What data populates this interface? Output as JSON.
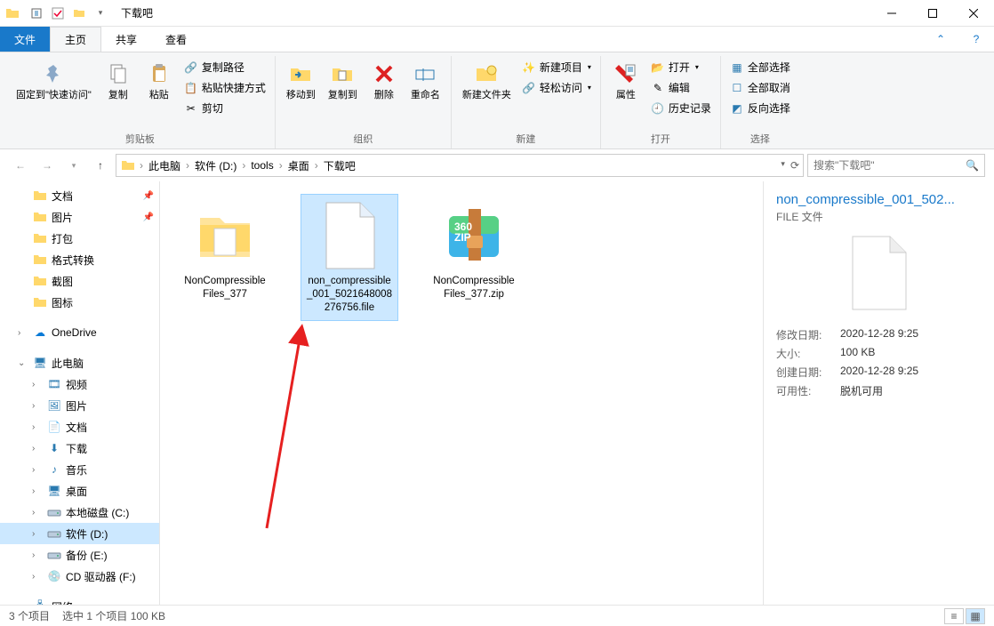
{
  "window": {
    "title": "下载吧"
  },
  "ribbon": {
    "tabs": {
      "file": "文件",
      "home": "主页",
      "share": "共享",
      "view": "查看"
    },
    "groups": {
      "clipboard": {
        "label": "剪贴板",
        "pin": "固定到\"快速访问\"",
        "copy": "复制",
        "paste": "粘贴",
        "copy_path": "复制路径",
        "paste_shortcut": "粘贴快捷方式",
        "cut": "剪切"
      },
      "organize": {
        "label": "组织",
        "move_to": "移动到",
        "copy_to": "复制到",
        "delete": "删除",
        "rename": "重命名"
      },
      "new": {
        "label": "新建",
        "new_folder": "新建文件夹",
        "new_item": "新建项目",
        "easy_access": "轻松访问"
      },
      "open": {
        "label": "打开",
        "properties": "属性",
        "open": "打开",
        "edit": "编辑",
        "history": "历史记录"
      },
      "select": {
        "label": "选择",
        "select_all": "全部选择",
        "select_none": "全部取消",
        "invert": "反向选择"
      }
    }
  },
  "breadcrumb": [
    "此电脑",
    "软件 (D:)",
    "tools",
    "桌面",
    "下载吧"
  ],
  "search": {
    "placeholder": "搜索\"下载吧\""
  },
  "tree": {
    "quick": [
      {
        "label": "文档",
        "pinned": true
      },
      {
        "label": "图片",
        "pinned": true
      },
      {
        "label": "打包"
      },
      {
        "label": "格式转换"
      },
      {
        "label": "截图"
      },
      {
        "label": "图标"
      }
    ],
    "onedrive": "OneDrive",
    "this_pc": "此电脑",
    "this_pc_children": [
      {
        "label": "视频"
      },
      {
        "label": "图片"
      },
      {
        "label": "文档"
      },
      {
        "label": "下载"
      },
      {
        "label": "音乐"
      },
      {
        "label": "桌面"
      },
      {
        "label": "本地磁盘 (C:)",
        "drive": true
      },
      {
        "label": "软件 (D:)",
        "drive": true,
        "selected": true
      },
      {
        "label": "备份 (E:)",
        "drive": true
      },
      {
        "label": "CD 驱动器 (F:)",
        "cd": true
      }
    ],
    "network": "网络"
  },
  "files": [
    {
      "name": "NonCompressibleFiles_377",
      "type": "folder"
    },
    {
      "name": "non_compressible_001_5021648008276756.file",
      "type": "file",
      "selected": true
    },
    {
      "name": "NonCompressibleFiles_377.zip",
      "type": "zip"
    }
  ],
  "details": {
    "title": "non_compressible_001_502...",
    "type": "FILE 文件",
    "rows": [
      {
        "k": "修改日期:",
        "v": "2020-12-28 9:25"
      },
      {
        "k": "大小:",
        "v": "100 KB"
      },
      {
        "k": "创建日期:",
        "v": "2020-12-28 9:25"
      },
      {
        "k": "可用性:",
        "v": "脱机可用"
      }
    ]
  },
  "status": {
    "count": "3 个项目",
    "selected": "选中 1 个项目  100 KB"
  }
}
